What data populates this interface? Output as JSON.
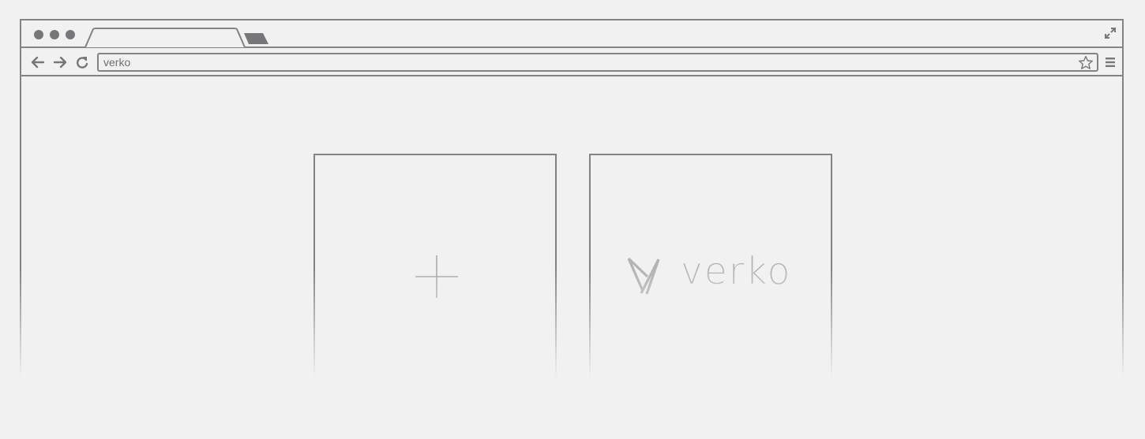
{
  "browser": {
    "window_controls": [
      "close",
      "minimize",
      "maximize"
    ],
    "active_tab_title": "",
    "omnibox": {
      "value": "verko"
    },
    "icons": {
      "back": "arrow-left-icon",
      "forward": "arrow-right-icon",
      "reload": "reload-icon",
      "bookmark": "star-icon",
      "menu": "hamburger-menu-icon",
      "fullscreen": "expand-icon"
    }
  },
  "new_tab_page": {
    "tiles": [
      {
        "type": "add",
        "icon": "plus-icon"
      },
      {
        "type": "site",
        "brand_name": "verko",
        "icon": "verko-logo-icon"
      }
    ]
  },
  "colors": {
    "chrome_stroke": "#838386",
    "background": "#f1f1f1",
    "logo_gray": "#b3b3b3"
  }
}
